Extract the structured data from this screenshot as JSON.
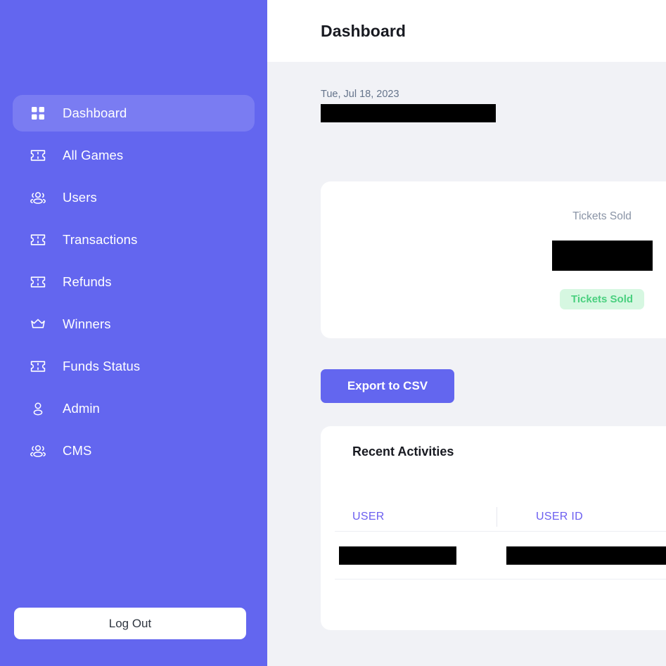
{
  "sidebar": {
    "items": [
      {
        "label": "Dashboard",
        "icon": "grid-icon",
        "active": true
      },
      {
        "label": "All Games",
        "icon": "ticket-icon",
        "active": false
      },
      {
        "label": "Users",
        "icon": "users-group-icon",
        "active": false
      },
      {
        "label": "Transactions",
        "icon": "ticket-icon",
        "active": false
      },
      {
        "label": "Refunds",
        "icon": "ticket-icon",
        "active": false
      },
      {
        "label": "Winners",
        "icon": "crown-icon",
        "active": false
      },
      {
        "label": "Funds Status",
        "icon": "ticket-icon",
        "active": false
      },
      {
        "label": "Admin",
        "icon": "user-icon",
        "active": false
      },
      {
        "label": "CMS",
        "icon": "users-group-icon",
        "active": false
      }
    ],
    "logout_label": "Log Out",
    "background_color": "#6366ef",
    "active_item_color": "#7a7cf2"
  },
  "header": {
    "title": "Dashboard"
  },
  "main": {
    "date_text": "Tue, Jul 18, 2023",
    "date_value_redacted": true,
    "stat_card": {
      "label": "Tickets Sold",
      "value_redacted": true,
      "badge_label": "Tickets Sold",
      "badge_bg_color": "#d6f7e1",
      "badge_text_color": "#4ad07f"
    },
    "export_button_label": "Export to CSV",
    "export_button_color": "#6366ef",
    "activities": {
      "title": "Recent Activities",
      "columns": [
        "USER",
        "USER ID"
      ],
      "column_header_color": "#6b5ef0",
      "rows": [
        {
          "user_redacted": true,
          "user_id_redacted": true
        }
      ]
    },
    "background_color": "#f1f2f6"
  }
}
